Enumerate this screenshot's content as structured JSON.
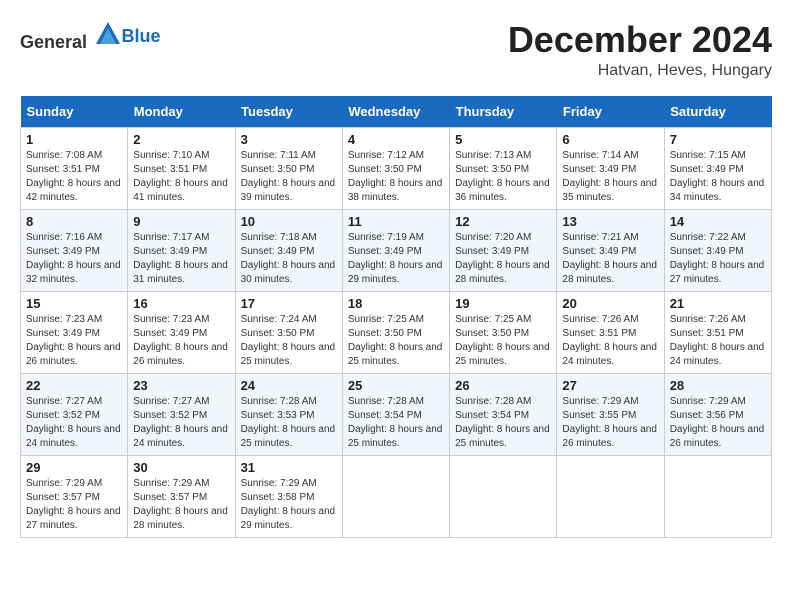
{
  "logo": {
    "general": "General",
    "blue": "Blue"
  },
  "header": {
    "month": "December 2024",
    "location": "Hatvan, Heves, Hungary"
  },
  "days_of_week": [
    "Sunday",
    "Monday",
    "Tuesday",
    "Wednesday",
    "Thursday",
    "Friday",
    "Saturday"
  ],
  "weeks": [
    [
      {
        "day": "1",
        "sunrise": "Sunrise: 7:08 AM",
        "sunset": "Sunset: 3:51 PM",
        "daylight": "Daylight: 8 hours and 42 minutes."
      },
      {
        "day": "2",
        "sunrise": "Sunrise: 7:10 AM",
        "sunset": "Sunset: 3:51 PM",
        "daylight": "Daylight: 8 hours and 41 minutes."
      },
      {
        "day": "3",
        "sunrise": "Sunrise: 7:11 AM",
        "sunset": "Sunset: 3:50 PM",
        "daylight": "Daylight: 8 hours and 39 minutes."
      },
      {
        "day": "4",
        "sunrise": "Sunrise: 7:12 AM",
        "sunset": "Sunset: 3:50 PM",
        "daylight": "Daylight: 8 hours and 38 minutes."
      },
      {
        "day": "5",
        "sunrise": "Sunrise: 7:13 AM",
        "sunset": "Sunset: 3:50 PM",
        "daylight": "Daylight: 8 hours and 36 minutes."
      },
      {
        "day": "6",
        "sunrise": "Sunrise: 7:14 AM",
        "sunset": "Sunset: 3:49 PM",
        "daylight": "Daylight: 8 hours and 35 minutes."
      },
      {
        "day": "7",
        "sunrise": "Sunrise: 7:15 AM",
        "sunset": "Sunset: 3:49 PM",
        "daylight": "Daylight: 8 hours and 34 minutes."
      }
    ],
    [
      {
        "day": "8",
        "sunrise": "Sunrise: 7:16 AM",
        "sunset": "Sunset: 3:49 PM",
        "daylight": "Daylight: 8 hours and 32 minutes."
      },
      {
        "day": "9",
        "sunrise": "Sunrise: 7:17 AM",
        "sunset": "Sunset: 3:49 PM",
        "daylight": "Daylight: 8 hours and 31 minutes."
      },
      {
        "day": "10",
        "sunrise": "Sunrise: 7:18 AM",
        "sunset": "Sunset: 3:49 PM",
        "daylight": "Daylight: 8 hours and 30 minutes."
      },
      {
        "day": "11",
        "sunrise": "Sunrise: 7:19 AM",
        "sunset": "Sunset: 3:49 PM",
        "daylight": "Daylight: 8 hours and 29 minutes."
      },
      {
        "day": "12",
        "sunrise": "Sunrise: 7:20 AM",
        "sunset": "Sunset: 3:49 PM",
        "daylight": "Daylight: 8 hours and 28 minutes."
      },
      {
        "day": "13",
        "sunrise": "Sunrise: 7:21 AM",
        "sunset": "Sunset: 3:49 PM",
        "daylight": "Daylight: 8 hours and 28 minutes."
      },
      {
        "day": "14",
        "sunrise": "Sunrise: 7:22 AM",
        "sunset": "Sunset: 3:49 PM",
        "daylight": "Daylight: 8 hours and 27 minutes."
      }
    ],
    [
      {
        "day": "15",
        "sunrise": "Sunrise: 7:23 AM",
        "sunset": "Sunset: 3:49 PM",
        "daylight": "Daylight: 8 hours and 26 minutes."
      },
      {
        "day": "16",
        "sunrise": "Sunrise: 7:23 AM",
        "sunset": "Sunset: 3:49 PM",
        "daylight": "Daylight: 8 hours and 26 minutes."
      },
      {
        "day": "17",
        "sunrise": "Sunrise: 7:24 AM",
        "sunset": "Sunset: 3:50 PM",
        "daylight": "Daylight: 8 hours and 25 minutes."
      },
      {
        "day": "18",
        "sunrise": "Sunrise: 7:25 AM",
        "sunset": "Sunset: 3:50 PM",
        "daylight": "Daylight: 8 hours and 25 minutes."
      },
      {
        "day": "19",
        "sunrise": "Sunrise: 7:25 AM",
        "sunset": "Sunset: 3:50 PM",
        "daylight": "Daylight: 8 hours and 25 minutes."
      },
      {
        "day": "20",
        "sunrise": "Sunrise: 7:26 AM",
        "sunset": "Sunset: 3:51 PM",
        "daylight": "Daylight: 8 hours and 24 minutes."
      },
      {
        "day": "21",
        "sunrise": "Sunrise: 7:26 AM",
        "sunset": "Sunset: 3:51 PM",
        "daylight": "Daylight: 8 hours and 24 minutes."
      }
    ],
    [
      {
        "day": "22",
        "sunrise": "Sunrise: 7:27 AM",
        "sunset": "Sunset: 3:52 PM",
        "daylight": "Daylight: 8 hours and 24 minutes."
      },
      {
        "day": "23",
        "sunrise": "Sunrise: 7:27 AM",
        "sunset": "Sunset: 3:52 PM",
        "daylight": "Daylight: 8 hours and 24 minutes."
      },
      {
        "day": "24",
        "sunrise": "Sunrise: 7:28 AM",
        "sunset": "Sunset: 3:53 PM",
        "daylight": "Daylight: 8 hours and 25 minutes."
      },
      {
        "day": "25",
        "sunrise": "Sunrise: 7:28 AM",
        "sunset": "Sunset: 3:54 PM",
        "daylight": "Daylight: 8 hours and 25 minutes."
      },
      {
        "day": "26",
        "sunrise": "Sunrise: 7:28 AM",
        "sunset": "Sunset: 3:54 PM",
        "daylight": "Daylight: 8 hours and 25 minutes."
      },
      {
        "day": "27",
        "sunrise": "Sunrise: 7:29 AM",
        "sunset": "Sunset: 3:55 PM",
        "daylight": "Daylight: 8 hours and 26 minutes."
      },
      {
        "day": "28",
        "sunrise": "Sunrise: 7:29 AM",
        "sunset": "Sunset: 3:56 PM",
        "daylight": "Daylight: 8 hours and 26 minutes."
      }
    ],
    [
      {
        "day": "29",
        "sunrise": "Sunrise: 7:29 AM",
        "sunset": "Sunset: 3:57 PM",
        "daylight": "Daylight: 8 hours and 27 minutes."
      },
      {
        "day": "30",
        "sunrise": "Sunrise: 7:29 AM",
        "sunset": "Sunset: 3:57 PM",
        "daylight": "Daylight: 8 hours and 28 minutes."
      },
      {
        "day": "31",
        "sunrise": "Sunrise: 7:29 AM",
        "sunset": "Sunset: 3:58 PM",
        "daylight": "Daylight: 8 hours and 29 minutes."
      },
      null,
      null,
      null,
      null
    ]
  ]
}
